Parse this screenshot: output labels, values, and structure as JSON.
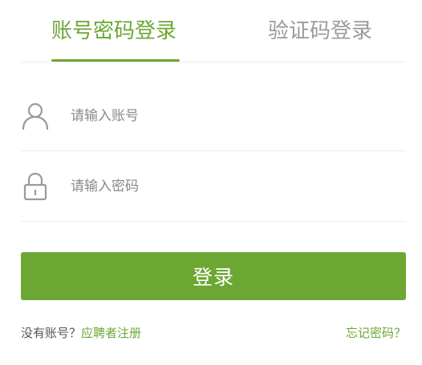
{
  "colors": {
    "accent": "#6ca734",
    "tab_inactive": "#9a9a9a",
    "icon": "#9a9a9a",
    "divider": "#ececec"
  },
  "tabs": [
    {
      "label": "账号密码登录",
      "active": true
    },
    {
      "label": "验证码登录",
      "active": false
    }
  ],
  "form": {
    "account": {
      "placeholder": "请输入账号",
      "value": "",
      "icon": "user-icon"
    },
    "password": {
      "placeholder": "请输入密码",
      "value": "",
      "icon": "lock-icon"
    },
    "submit_label": "登录"
  },
  "footer": {
    "no_account_text": "没有账号？",
    "register_link": "应聘者注册",
    "forgot_link": "忘记密码？"
  }
}
